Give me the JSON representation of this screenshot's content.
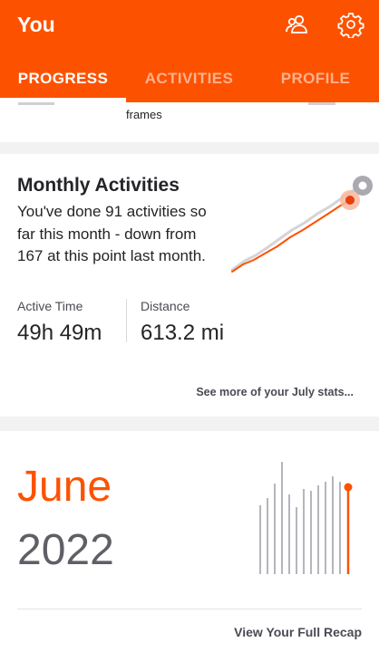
{
  "header": {
    "title": "You",
    "icons": [
      "people-icon",
      "gear-icon"
    ]
  },
  "tabs": [
    {
      "label": "PROGRESS",
      "active": true
    },
    {
      "label": "ACTIVITIES",
      "active": false
    },
    {
      "label": "PROFILE",
      "active": false
    }
  ],
  "strip": {
    "fragment_text": "frames"
  },
  "monthly": {
    "heading": "Monthly Activities",
    "description": "You've done 91 activities so far this month - down from 167 at this point last month.",
    "stats": [
      {
        "label": "Active Time",
        "value": "49h 49m"
      },
      {
        "label": "Distance",
        "value": "613.2 mi"
      }
    ],
    "link": "See more of your July stats..."
  },
  "recap": {
    "month": "June",
    "year": "2022",
    "link": "View Your Full Recap"
  },
  "colors": {
    "brand": "#fc5200",
    "ghost_line": "#d4d4d8",
    "recap_bar": "#b5b5bd"
  }
}
